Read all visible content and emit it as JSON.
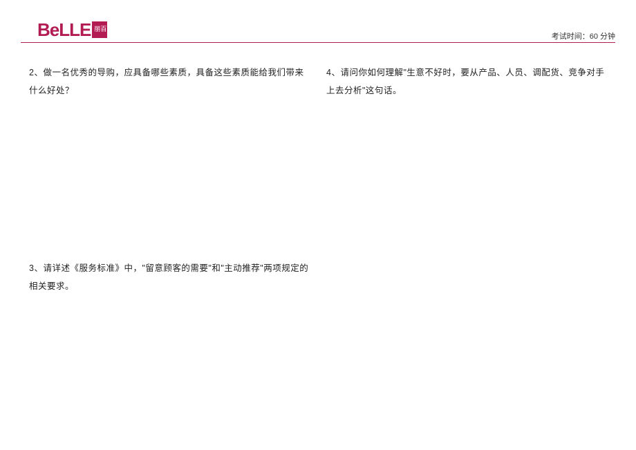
{
  "header": {
    "logo_text": "BeLLE",
    "logo_cn": "百丽",
    "exam_time_label": "考试时间：",
    "exam_time_value": "60 分钟"
  },
  "questions": {
    "q2": "2、做一名优秀的导购，应具备哪些素质，具备这些素质能给我们带来什么好处？",
    "q3": "3、请详述《服务标准》中，\"留意顾客的需要\"和\"主动推荐\"两项规定的相关要求。",
    "q4": "4、请问你如何理解\"生意不好时，要从产品、人员、调配货、竞争对手上去分析\"这句话。"
  }
}
